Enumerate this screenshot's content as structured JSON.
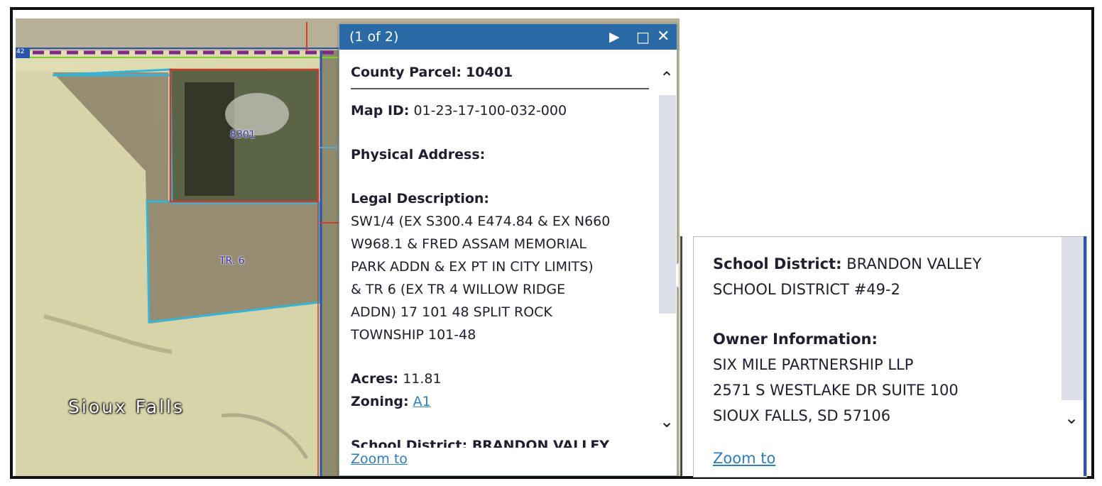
{
  "map": {
    "town_label": "Sioux Falls",
    "parcel_labels": [
      "8301",
      "TR. 6"
    ],
    "route_badge": "42"
  },
  "popup1": {
    "counter": "(1 of 2)",
    "county_parcel_label": "County Parcel:",
    "county_parcel_value": "10401",
    "map_id_label": "Map ID:",
    "map_id_value": "01-23-17-100-032-000",
    "physical_address_label": "Physical Address:",
    "legal_description_label": "Legal Description:",
    "legal_description_lines": [
      "SW1/4 (EX S300.4 E474.84 & EX N660",
      "W968.1 & FRED ASSAM MEMORIAL",
      "PARK ADDN & EX PT IN CITY LIMITS)",
      "& TR 6 (EX TR 4 WILLOW RIDGE",
      "ADDN) 17 101 48 SPLIT ROCK",
      "TOWNSHIP 101-48"
    ],
    "acres_label": "Acres:",
    "acres_value": "11.81",
    "zoning_label": "Zoning:",
    "zoning_value": "A1",
    "cutoff_line": "School District: BRANDON VALLEY",
    "zoom_to": "Zoom to"
  },
  "popup2": {
    "school_district_label": "School District:",
    "school_district_line1": "BRANDON VALLEY",
    "school_district_line2": "SCHOOL DISTRICT #49-2",
    "owner_label": "Owner Information:",
    "owner_lines": [
      "SIX MILE PARTNERSHIP LLP",
      "2571 S WESTLAKE DR SUITE 100",
      "SIOUX FALLS, SD 57106"
    ],
    "zoom_to": "Zoom to"
  },
  "icons": {
    "next": "play-triangle",
    "maximize": "square",
    "close": "x",
    "scroll_up": "chevron-up",
    "scroll_down": "chevron-down"
  }
}
